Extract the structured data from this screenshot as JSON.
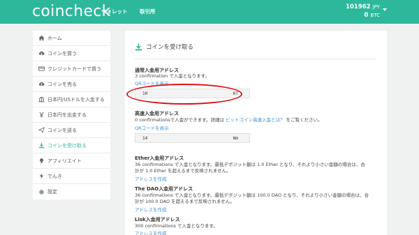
{
  "header": {
    "logo": "coincheck",
    "nav": {
      "wallet": "ウォレット",
      "exchange": "取引所"
    },
    "balance": {
      "jpy_value": "101962",
      "jpy_unit": "JPY",
      "btc_value": "0",
      "btc_unit": "BTC"
    }
  },
  "sidebar": {
    "items": [
      {
        "label": "ホーム",
        "icon": "home-icon"
      },
      {
        "label": "コインを買う",
        "icon": "cloud-download-icon"
      },
      {
        "label": "クレジットカードで買う",
        "icon": "credit-card-icon"
      },
      {
        "label": "コインを売る",
        "icon": "cloud-upload-icon"
      },
      {
        "label": "日本円/USドルを入金する",
        "icon": "bank-icon"
      },
      {
        "label": "日本円を出金する",
        "icon": "yen-icon"
      },
      {
        "label": "コインを送る",
        "icon": "send-icon"
      },
      {
        "label": "コインを受け取る",
        "icon": "download-icon",
        "active": true
      },
      {
        "label": "アフィリエイト",
        "icon": "lightbulb-icon"
      },
      {
        "label": "でんき",
        "icon": "bolt-icon"
      },
      {
        "label": "設定",
        "icon": "gear-icon"
      }
    ]
  },
  "main": {
    "title": "コインを受け取る",
    "normal": {
      "heading": "通常入金用アドレス",
      "desc": "3 confirmation で入金となります。",
      "qr_link": "QRコードを表示",
      "address_start": "1H",
      "address_end": "KT"
    },
    "fast": {
      "heading": "高速入金用アドレス",
      "desc_before": "0 confirmationsで入金ができます。詳細は ",
      "desc_link": "ビットコイン高速入金とは？",
      "desc_after": " をご覧ください。",
      "qr_link": "QRコードを表示",
      "address_start": "14",
      "address_end": "Wm"
    },
    "ether": {
      "heading": "Ether入金用アドレス",
      "desc_line1": "36 confirmations で入金となります。最低デポジット額は 1.0 Ether となり、それより小さい金額の場合は、合",
      "desc_line2": "計が 1.0 Ether を超えるまで反映されません。",
      "link": "アドレスを作成"
    },
    "dao": {
      "heading": "The DAO入金用アドレス",
      "desc_line1": "36 confirmations で入金となります。最低デポジット額は 100.0 DAO となり、それより小さい金額の場合は、合",
      "desc_line2": "計が 100.0 DAO を超えるまで反映されません。",
      "link": "アドレスを作成"
    },
    "lisk": {
      "heading": "Lisk入金用アドレス",
      "desc": "300 confirmations で入金となります。",
      "link": "アドレスを作成"
    }
  },
  "colors": {
    "brand": "#2db89b",
    "link": "#3a8fd0",
    "annotation": "#d9141c"
  }
}
